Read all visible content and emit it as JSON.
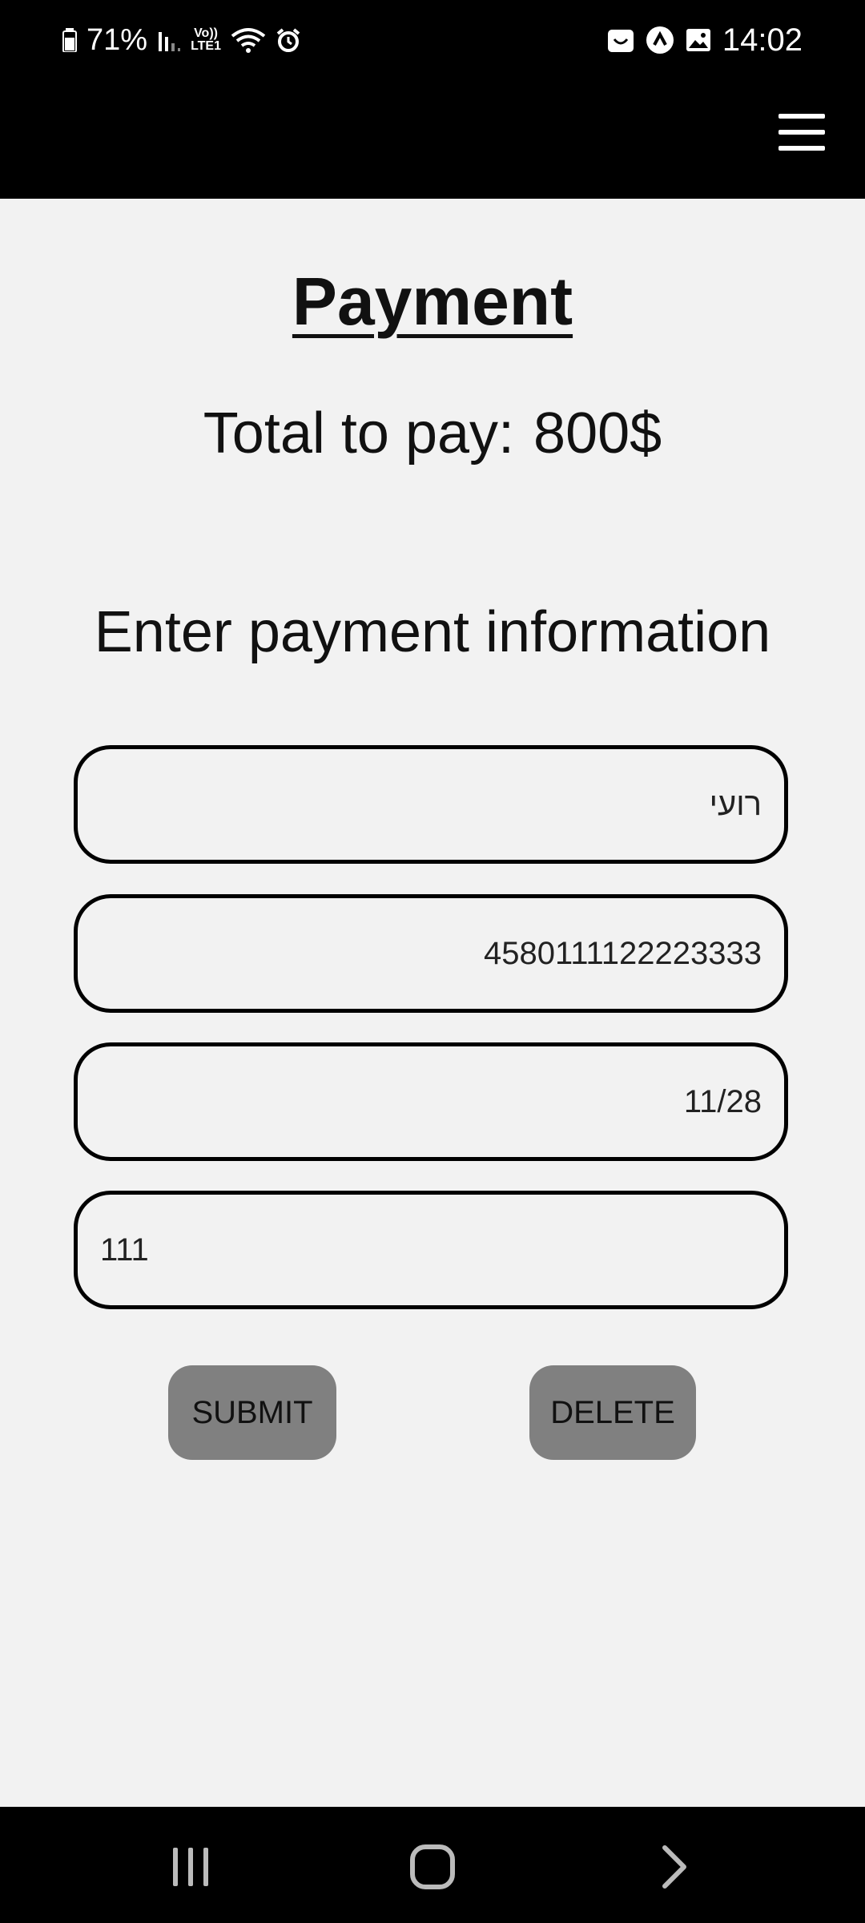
{
  "status_bar": {
    "battery": "71%",
    "volte": "Vo))\nLTE1",
    "time": "14:02",
    "icons_left": [
      "battery-icon",
      "signal-icon",
      "volte-icon",
      "wifi-icon",
      "alarm-icon"
    ],
    "icons_right": [
      "shop-icon",
      "app-icon",
      "gallery-icon"
    ]
  },
  "app_bar": {
    "menu_icon": "hamburger-menu-icon"
  },
  "page": {
    "title": "Payment",
    "total_label": "Total to pay:",
    "total_amount": "800$",
    "section_title": "Enter payment information"
  },
  "form": {
    "name_value": "רועי",
    "card_number_value": "4580111122223333",
    "expiry_value": "11/28",
    "cvv_value": "111"
  },
  "buttons": {
    "submit_label": "SUBMIT",
    "delete_label": "DELETE"
  },
  "colors": {
    "bar_background": "#000000",
    "page_background": "#f2f2f2",
    "button_background": "#808080"
  },
  "nav_bar": {
    "icons": [
      "recent-apps-icon",
      "home-icon",
      "back-icon"
    ]
  }
}
